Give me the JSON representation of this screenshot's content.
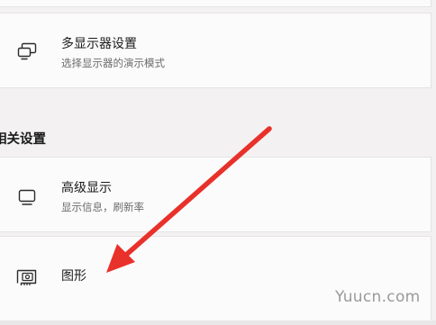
{
  "settings": {
    "multi_display": {
      "title": "多显示器设置",
      "subtitle": "选择显示器的演示模式",
      "icon": "multi-monitor-icon"
    },
    "related_heading": "相关设置",
    "advanced_display": {
      "title": "高级显示",
      "subtitle": "显示信息，刷新率",
      "icon": "monitor-icon"
    },
    "graphics": {
      "title": "图形",
      "icon": "graphics-card-icon"
    }
  },
  "annotation": {
    "arrow_color": "#e8312a"
  },
  "watermark": "Yuucn.com"
}
